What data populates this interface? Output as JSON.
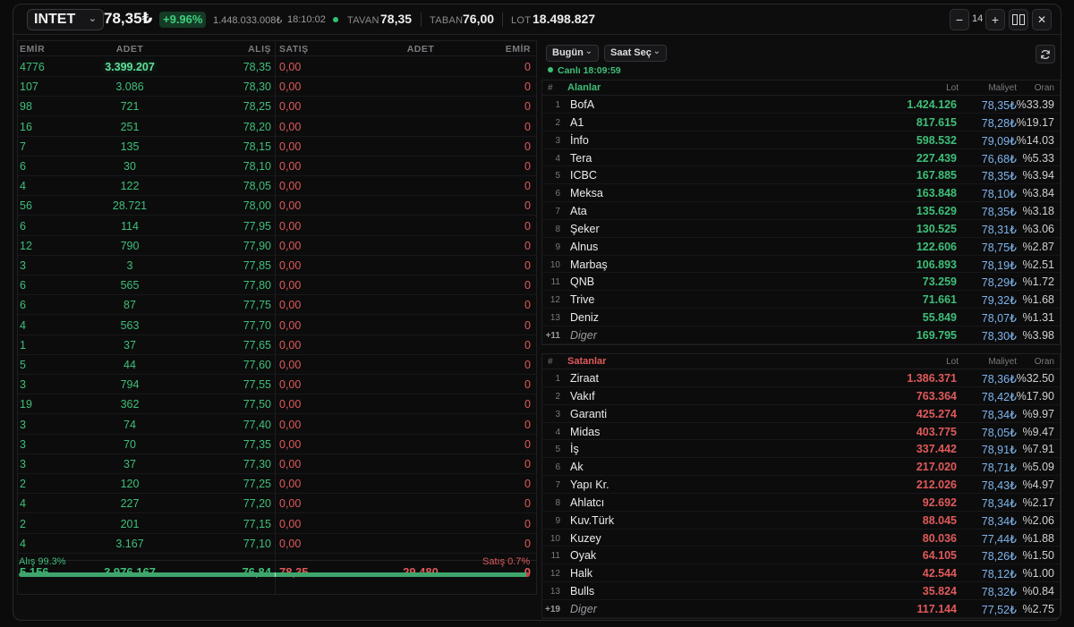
{
  "header": {
    "symbol": "INTET",
    "price": "78,35₺",
    "change": "+9.96%",
    "volume": "1.448.033.008₺",
    "time": "18:10:02",
    "tavan_label": "TAVAN",
    "tavan_value": "78,35",
    "taban_label": "TABAN",
    "taban_value": "76,00",
    "lot_label": "LOT",
    "lot_value": "18.498.827",
    "depth_count": "14",
    "minus": "−",
    "plus": "+",
    "close": "✕"
  },
  "book": {
    "headers": {
      "emir": "EMİR",
      "adet": "ADET",
      "alis": "ALIŞ",
      "satis": "SATIŞ",
      "sadet": "ADET",
      "semir": "EMİR"
    },
    "rows": [
      {
        "emir": "4776",
        "adet": "3.399.207",
        "alis": "78,35",
        "satis": "0,00",
        "semir": "0"
      },
      {
        "emir": "107",
        "adet": "3.086",
        "alis": "78,30",
        "satis": "0,00",
        "semir": "0"
      },
      {
        "emir": "98",
        "adet": "721",
        "alis": "78,25",
        "satis": "0,00",
        "semir": "0"
      },
      {
        "emir": "16",
        "adet": "251",
        "alis": "78,20",
        "satis": "0,00",
        "semir": "0"
      },
      {
        "emir": "7",
        "adet": "135",
        "alis": "78,15",
        "satis": "0,00",
        "semir": "0"
      },
      {
        "emir": "6",
        "adet": "30",
        "alis": "78,10",
        "satis": "0,00",
        "semir": "0"
      },
      {
        "emir": "4",
        "adet": "122",
        "alis": "78,05",
        "satis": "0,00",
        "semir": "0"
      },
      {
        "emir": "56",
        "adet": "28.721",
        "alis": "78,00",
        "satis": "0,00",
        "semir": "0"
      },
      {
        "emir": "6",
        "adet": "114",
        "alis": "77,95",
        "satis": "0,00",
        "semir": "0"
      },
      {
        "emir": "12",
        "adet": "790",
        "alis": "77,90",
        "satis": "0,00",
        "semir": "0"
      },
      {
        "emir": "3",
        "adet": "3",
        "alis": "77,85",
        "satis": "0,00",
        "semir": "0"
      },
      {
        "emir": "6",
        "adet": "565",
        "alis": "77,80",
        "satis": "0,00",
        "semir": "0"
      },
      {
        "emir": "6",
        "adet": "87",
        "alis": "77,75",
        "satis": "0,00",
        "semir": "0"
      },
      {
        "emir": "4",
        "adet": "563",
        "alis": "77,70",
        "satis": "0,00",
        "semir": "0"
      },
      {
        "emir": "1",
        "adet": "37",
        "alis": "77,65",
        "satis": "0,00",
        "semir": "0"
      },
      {
        "emir": "5",
        "adet": "44",
        "alis": "77,60",
        "satis": "0,00",
        "semir": "0"
      },
      {
        "emir": "3",
        "adet": "794",
        "alis": "77,55",
        "satis": "0,00",
        "semir": "0"
      },
      {
        "emir": "19",
        "adet": "362",
        "alis": "77,50",
        "satis": "0,00",
        "semir": "0"
      },
      {
        "emir": "3",
        "adet": "74",
        "alis": "77,40",
        "satis": "0,00",
        "semir": "0"
      },
      {
        "emir": "3",
        "adet": "70",
        "alis": "77,35",
        "satis": "0,00",
        "semir": "0"
      },
      {
        "emir": "3",
        "adet": "37",
        "alis": "77,30",
        "satis": "0,00",
        "semir": "0"
      },
      {
        "emir": "2",
        "adet": "120",
        "alis": "77,25",
        "satis": "0,00",
        "semir": "0"
      },
      {
        "emir": "4",
        "adet": "227",
        "alis": "77,20",
        "satis": "0,00",
        "semir": "0"
      },
      {
        "emir": "2",
        "adet": "201",
        "alis": "77,15",
        "satis": "0,00",
        "semir": "0"
      },
      {
        "emir": "4",
        "adet": "3.167",
        "alis": "77,10",
        "satis": "0,00",
        "semir": "0"
      }
    ],
    "footer": {
      "emir": "5.156",
      "adet": "3.976.167",
      "alis": "76,84",
      "satis": "78,35",
      "sadet": "29.480",
      "semir": "0"
    },
    "buy_ratio_label": "Alış 99.3%",
    "sell_ratio_label": "Satış 0.7%",
    "buy_ratio": 0.993
  },
  "panel": {
    "period": "Bugün",
    "time_select": "Saat Seç",
    "live": "Canlı 18:09:59",
    "buyers": {
      "hash": "#",
      "title": "Alanlar",
      "lot_h": "Lot",
      "cost_h": "Maliyet",
      "pct_h": "Oran",
      "rows": [
        {
          "rank": "1",
          "name": "BofA",
          "lot": "1.424.126",
          "cost": "78,35₺",
          "pct": "%33.39"
        },
        {
          "rank": "2",
          "name": "A1",
          "lot": "817.615",
          "cost": "78,28₺",
          "pct": "%19.17"
        },
        {
          "rank": "3",
          "name": "İnfo",
          "lot": "598.532",
          "cost": "79,09₺",
          "pct": "%14.03"
        },
        {
          "rank": "4",
          "name": "Tera",
          "lot": "227.439",
          "cost": "76,68₺",
          "pct": "%5.33"
        },
        {
          "rank": "5",
          "name": "ICBC",
          "lot": "167.885",
          "cost": "78,35₺",
          "pct": "%3.94"
        },
        {
          "rank": "6",
          "name": "Meksa",
          "lot": "163.848",
          "cost": "78,10₺",
          "pct": "%3.84"
        },
        {
          "rank": "7",
          "name": "Ata",
          "lot": "135.629",
          "cost": "78,35₺",
          "pct": "%3.18"
        },
        {
          "rank": "8",
          "name": "Şeker",
          "lot": "130.525",
          "cost": "78,31₺",
          "pct": "%3.06"
        },
        {
          "rank": "9",
          "name": "Alnus",
          "lot": "122.606",
          "cost": "78,75₺",
          "pct": "%2.87"
        },
        {
          "rank": "10",
          "name": "Marbaş",
          "lot": "106.893",
          "cost": "78,19₺",
          "pct": "%2.51"
        },
        {
          "rank": "11",
          "name": "QNB",
          "lot": "73.259",
          "cost": "78,29₺",
          "pct": "%1.72"
        },
        {
          "rank": "12",
          "name": "Trive",
          "lot": "71.661",
          "cost": "79,32₺",
          "pct": "%1.68"
        },
        {
          "rank": "13",
          "name": "Deniz",
          "lot": "55.849",
          "cost": "78,07₺",
          "pct": "%1.31"
        }
      ],
      "other": {
        "rank": "+11",
        "name": "Diger",
        "lot": "169.795",
        "cost": "78,30₺",
        "pct": "%3.98"
      }
    },
    "sellers": {
      "hash": "#",
      "title": "Satanlar",
      "lot_h": "Lot",
      "cost_h": "Maliyet",
      "pct_h": "Oran",
      "rows": [
        {
          "rank": "1",
          "name": "Ziraat",
          "lot": "1.386.371",
          "cost": "78,36₺",
          "pct": "%32.50"
        },
        {
          "rank": "2",
          "name": "Vakıf",
          "lot": "763.364",
          "cost": "78,42₺",
          "pct": "%17.90"
        },
        {
          "rank": "3",
          "name": "Garanti",
          "lot": "425.274",
          "cost": "78,34₺",
          "pct": "%9.97"
        },
        {
          "rank": "4",
          "name": "Midas",
          "lot": "403.775",
          "cost": "78,05₺",
          "pct": "%9.47"
        },
        {
          "rank": "5",
          "name": "İş",
          "lot": "337.442",
          "cost": "78,91₺",
          "pct": "%7.91"
        },
        {
          "rank": "6",
          "name": "Ak",
          "lot": "217.020",
          "cost": "78,71₺",
          "pct": "%5.09"
        },
        {
          "rank": "7",
          "name": "Yapı Kr.",
          "lot": "212.026",
          "cost": "78,43₺",
          "pct": "%4.97"
        },
        {
          "rank": "8",
          "name": "Ahlatcı",
          "lot": "92.692",
          "cost": "78,34₺",
          "pct": "%2.17"
        },
        {
          "rank": "9",
          "name": "Kuv.Türk",
          "lot": "88.045",
          "cost": "78,34₺",
          "pct": "%2.06"
        },
        {
          "rank": "10",
          "name": "Kuzey",
          "lot": "80.036",
          "cost": "77,44₺",
          "pct": "%1.88"
        },
        {
          "rank": "11",
          "name": "Oyak",
          "lot": "64.105",
          "cost": "78,26₺",
          "pct": "%1.50"
        },
        {
          "rank": "12",
          "name": "Halk",
          "lot": "42.544",
          "cost": "78,12₺",
          "pct": "%1.00"
        },
        {
          "rank": "13",
          "name": "Bulls",
          "lot": "35.824",
          "cost": "78,32₺",
          "pct": "%0.84"
        }
      ],
      "other": {
        "rank": "+19",
        "name": "Diger",
        "lot": "117.144",
        "cost": "77,52₺",
        "pct": "%2.75"
      }
    }
  }
}
